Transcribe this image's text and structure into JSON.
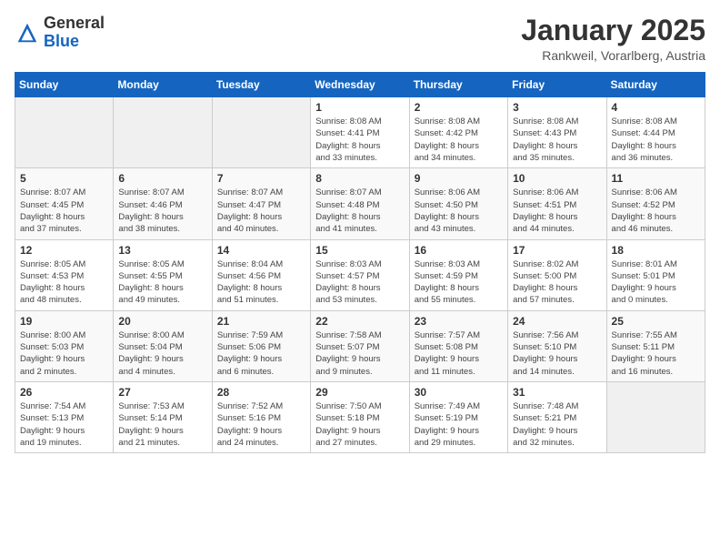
{
  "header": {
    "logo_general": "General",
    "logo_blue": "Blue",
    "month_title": "January 2025",
    "subtitle": "Rankweil, Vorarlberg, Austria"
  },
  "days_of_week": [
    "Sunday",
    "Monday",
    "Tuesday",
    "Wednesday",
    "Thursday",
    "Friday",
    "Saturday"
  ],
  "weeks": [
    [
      {
        "day": "",
        "info": ""
      },
      {
        "day": "",
        "info": ""
      },
      {
        "day": "",
        "info": ""
      },
      {
        "day": "1",
        "info": "Sunrise: 8:08 AM\nSunset: 4:41 PM\nDaylight: 8 hours\nand 33 minutes."
      },
      {
        "day": "2",
        "info": "Sunrise: 8:08 AM\nSunset: 4:42 PM\nDaylight: 8 hours\nand 34 minutes."
      },
      {
        "day": "3",
        "info": "Sunrise: 8:08 AM\nSunset: 4:43 PM\nDaylight: 8 hours\nand 35 minutes."
      },
      {
        "day": "4",
        "info": "Sunrise: 8:08 AM\nSunset: 4:44 PM\nDaylight: 8 hours\nand 36 minutes."
      }
    ],
    [
      {
        "day": "5",
        "info": "Sunrise: 8:07 AM\nSunset: 4:45 PM\nDaylight: 8 hours\nand 37 minutes."
      },
      {
        "day": "6",
        "info": "Sunrise: 8:07 AM\nSunset: 4:46 PM\nDaylight: 8 hours\nand 38 minutes."
      },
      {
        "day": "7",
        "info": "Sunrise: 8:07 AM\nSunset: 4:47 PM\nDaylight: 8 hours\nand 40 minutes."
      },
      {
        "day": "8",
        "info": "Sunrise: 8:07 AM\nSunset: 4:48 PM\nDaylight: 8 hours\nand 41 minutes."
      },
      {
        "day": "9",
        "info": "Sunrise: 8:06 AM\nSunset: 4:50 PM\nDaylight: 8 hours\nand 43 minutes."
      },
      {
        "day": "10",
        "info": "Sunrise: 8:06 AM\nSunset: 4:51 PM\nDaylight: 8 hours\nand 44 minutes."
      },
      {
        "day": "11",
        "info": "Sunrise: 8:06 AM\nSunset: 4:52 PM\nDaylight: 8 hours\nand 46 minutes."
      }
    ],
    [
      {
        "day": "12",
        "info": "Sunrise: 8:05 AM\nSunset: 4:53 PM\nDaylight: 8 hours\nand 48 minutes."
      },
      {
        "day": "13",
        "info": "Sunrise: 8:05 AM\nSunset: 4:55 PM\nDaylight: 8 hours\nand 49 minutes."
      },
      {
        "day": "14",
        "info": "Sunrise: 8:04 AM\nSunset: 4:56 PM\nDaylight: 8 hours\nand 51 minutes."
      },
      {
        "day": "15",
        "info": "Sunrise: 8:03 AM\nSunset: 4:57 PM\nDaylight: 8 hours\nand 53 minutes."
      },
      {
        "day": "16",
        "info": "Sunrise: 8:03 AM\nSunset: 4:59 PM\nDaylight: 8 hours\nand 55 minutes."
      },
      {
        "day": "17",
        "info": "Sunrise: 8:02 AM\nSunset: 5:00 PM\nDaylight: 8 hours\nand 57 minutes."
      },
      {
        "day": "18",
        "info": "Sunrise: 8:01 AM\nSunset: 5:01 PM\nDaylight: 9 hours\nand 0 minutes."
      }
    ],
    [
      {
        "day": "19",
        "info": "Sunrise: 8:00 AM\nSunset: 5:03 PM\nDaylight: 9 hours\nand 2 minutes."
      },
      {
        "day": "20",
        "info": "Sunrise: 8:00 AM\nSunset: 5:04 PM\nDaylight: 9 hours\nand 4 minutes."
      },
      {
        "day": "21",
        "info": "Sunrise: 7:59 AM\nSunset: 5:06 PM\nDaylight: 9 hours\nand 6 minutes."
      },
      {
        "day": "22",
        "info": "Sunrise: 7:58 AM\nSunset: 5:07 PM\nDaylight: 9 hours\nand 9 minutes."
      },
      {
        "day": "23",
        "info": "Sunrise: 7:57 AM\nSunset: 5:08 PM\nDaylight: 9 hours\nand 11 minutes."
      },
      {
        "day": "24",
        "info": "Sunrise: 7:56 AM\nSunset: 5:10 PM\nDaylight: 9 hours\nand 14 minutes."
      },
      {
        "day": "25",
        "info": "Sunrise: 7:55 AM\nSunset: 5:11 PM\nDaylight: 9 hours\nand 16 minutes."
      }
    ],
    [
      {
        "day": "26",
        "info": "Sunrise: 7:54 AM\nSunset: 5:13 PM\nDaylight: 9 hours\nand 19 minutes."
      },
      {
        "day": "27",
        "info": "Sunrise: 7:53 AM\nSunset: 5:14 PM\nDaylight: 9 hours\nand 21 minutes."
      },
      {
        "day": "28",
        "info": "Sunrise: 7:52 AM\nSunset: 5:16 PM\nDaylight: 9 hours\nand 24 minutes."
      },
      {
        "day": "29",
        "info": "Sunrise: 7:50 AM\nSunset: 5:18 PM\nDaylight: 9 hours\nand 27 minutes."
      },
      {
        "day": "30",
        "info": "Sunrise: 7:49 AM\nSunset: 5:19 PM\nDaylight: 9 hours\nand 29 minutes."
      },
      {
        "day": "31",
        "info": "Sunrise: 7:48 AM\nSunset: 5:21 PM\nDaylight: 9 hours\nand 32 minutes."
      },
      {
        "day": "",
        "info": ""
      }
    ]
  ]
}
